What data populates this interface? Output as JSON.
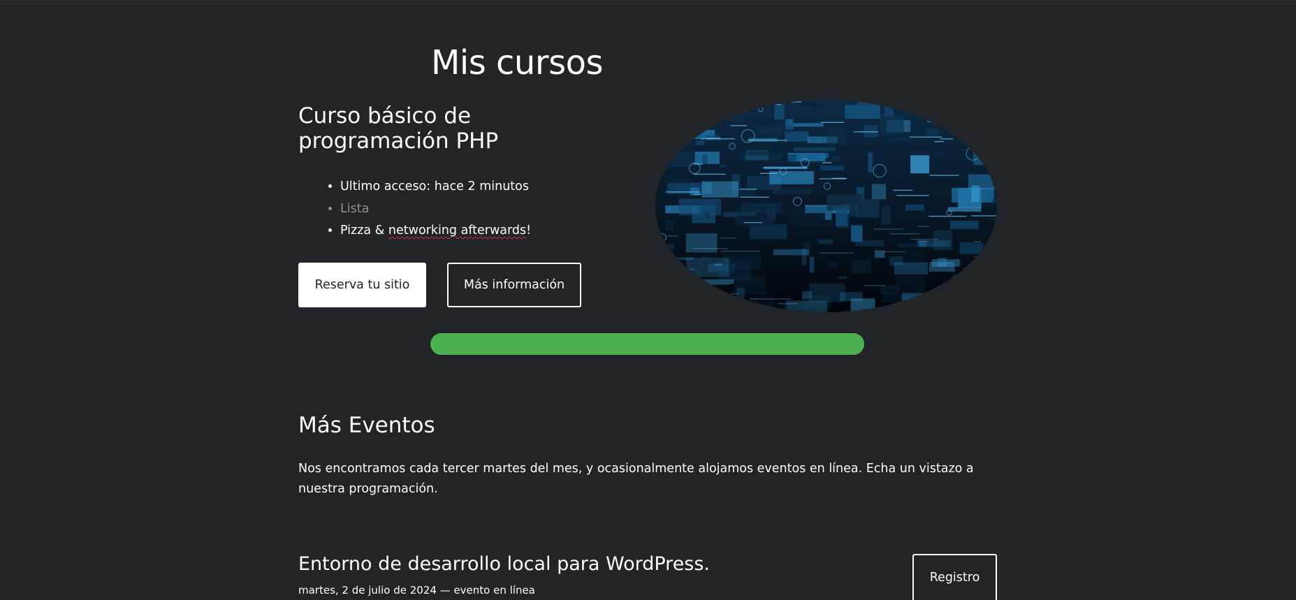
{
  "page": {
    "title": "Mis cursos"
  },
  "course": {
    "title": "Curso básico de programación PHP",
    "details": [
      "Ultimo acceso: hace 2 minutos",
      "Lista",
      "Pizza & networking afterwards!"
    ],
    "details_parts": {
      "item3_before": "Pizza & ",
      "item3_misspelled": "networking afterwards",
      "item3_after": "!"
    },
    "reserve_label": "Reserva tu sitio",
    "info_label": "Más información",
    "image_icon": "dashboard-screens-image",
    "progress_percent": 100,
    "progress_color": "#4caf50"
  },
  "events": {
    "title": "Más Eventos",
    "description": "Nos encontramos cada tercer martes del mes, y ocasionalmente alojamos eventos en línea. Echa un vistazo a nuestra programación.",
    "items": [
      {
        "title": "Entorno de desarrollo local para WordPress.",
        "meta": "martes, 2 de julio de 2024 — evento en línea",
        "register_label": "Registro"
      }
    ]
  },
  "colors": {
    "background": "#212529",
    "text": "#ffffff",
    "muted": "#8d9297"
  }
}
